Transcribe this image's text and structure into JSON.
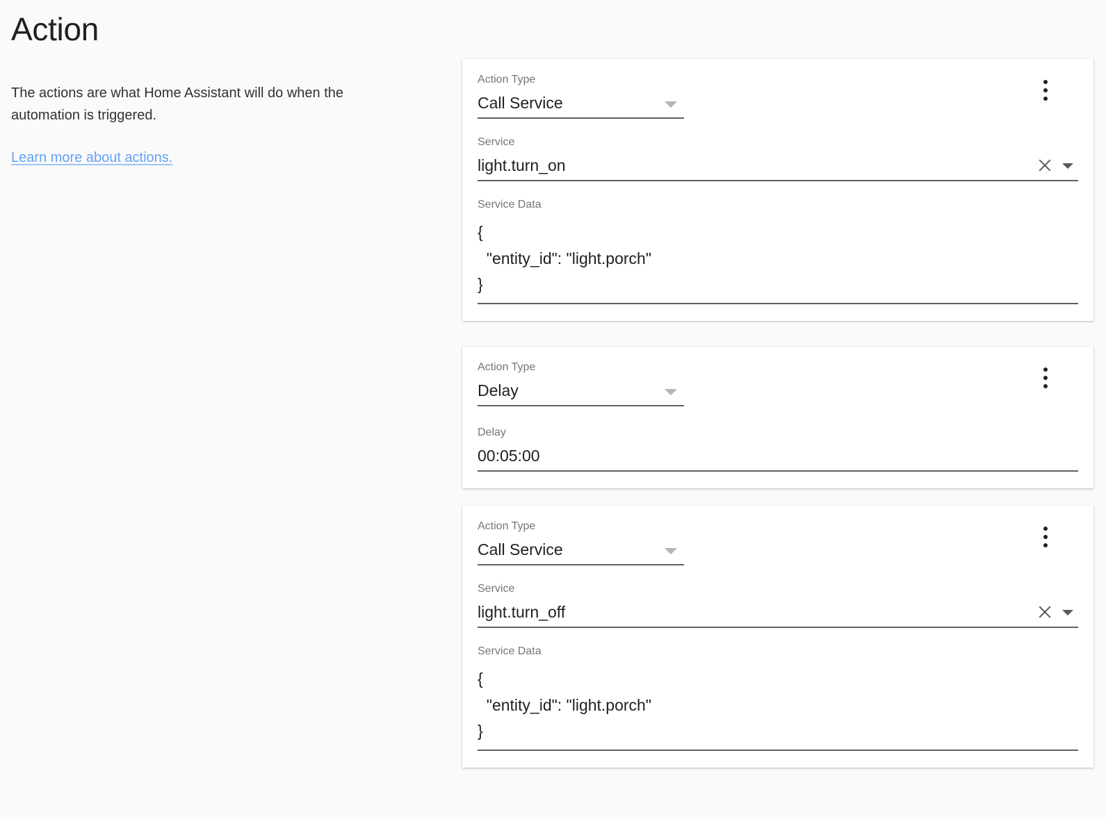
{
  "page": {
    "title": "Action",
    "description": "The actions are what Home Assistant will do when the automation is triggered.",
    "link_label": "Learn more about actions."
  },
  "icons": {
    "overflow": "dots-vertical-icon",
    "caret": "chevron-down-icon",
    "clear": "close-icon"
  },
  "labels": {
    "action_type": "Action Type",
    "service": "Service",
    "service_data": "Service Data",
    "delay": "Delay"
  },
  "colors": {
    "page_background": "#fafafa",
    "card_background": "#ffffff",
    "link": "#64a1f4",
    "label_text": "#757575",
    "value_text": "#1f1f1f",
    "underline": "#5f5f5f"
  },
  "actions": [
    {
      "type_label": "Action Type",
      "type_value": "Call Service",
      "service_label": "Service",
      "service_value": "light.turn_on",
      "service_data_label": "Service Data",
      "service_data_value": "{\n  \"entity_id\": \"light.porch\"\n}"
    },
    {
      "type_label": "Action Type",
      "type_value": "Delay",
      "delay_label": "Delay",
      "delay_value": "00:05:00"
    },
    {
      "type_label": "Action Type",
      "type_value": "Call Service",
      "service_label": "Service",
      "service_value": "light.turn_off",
      "service_data_label": "Service Data",
      "service_data_value": "{\n  \"entity_id\": \"light.porch\"\n}"
    }
  ]
}
